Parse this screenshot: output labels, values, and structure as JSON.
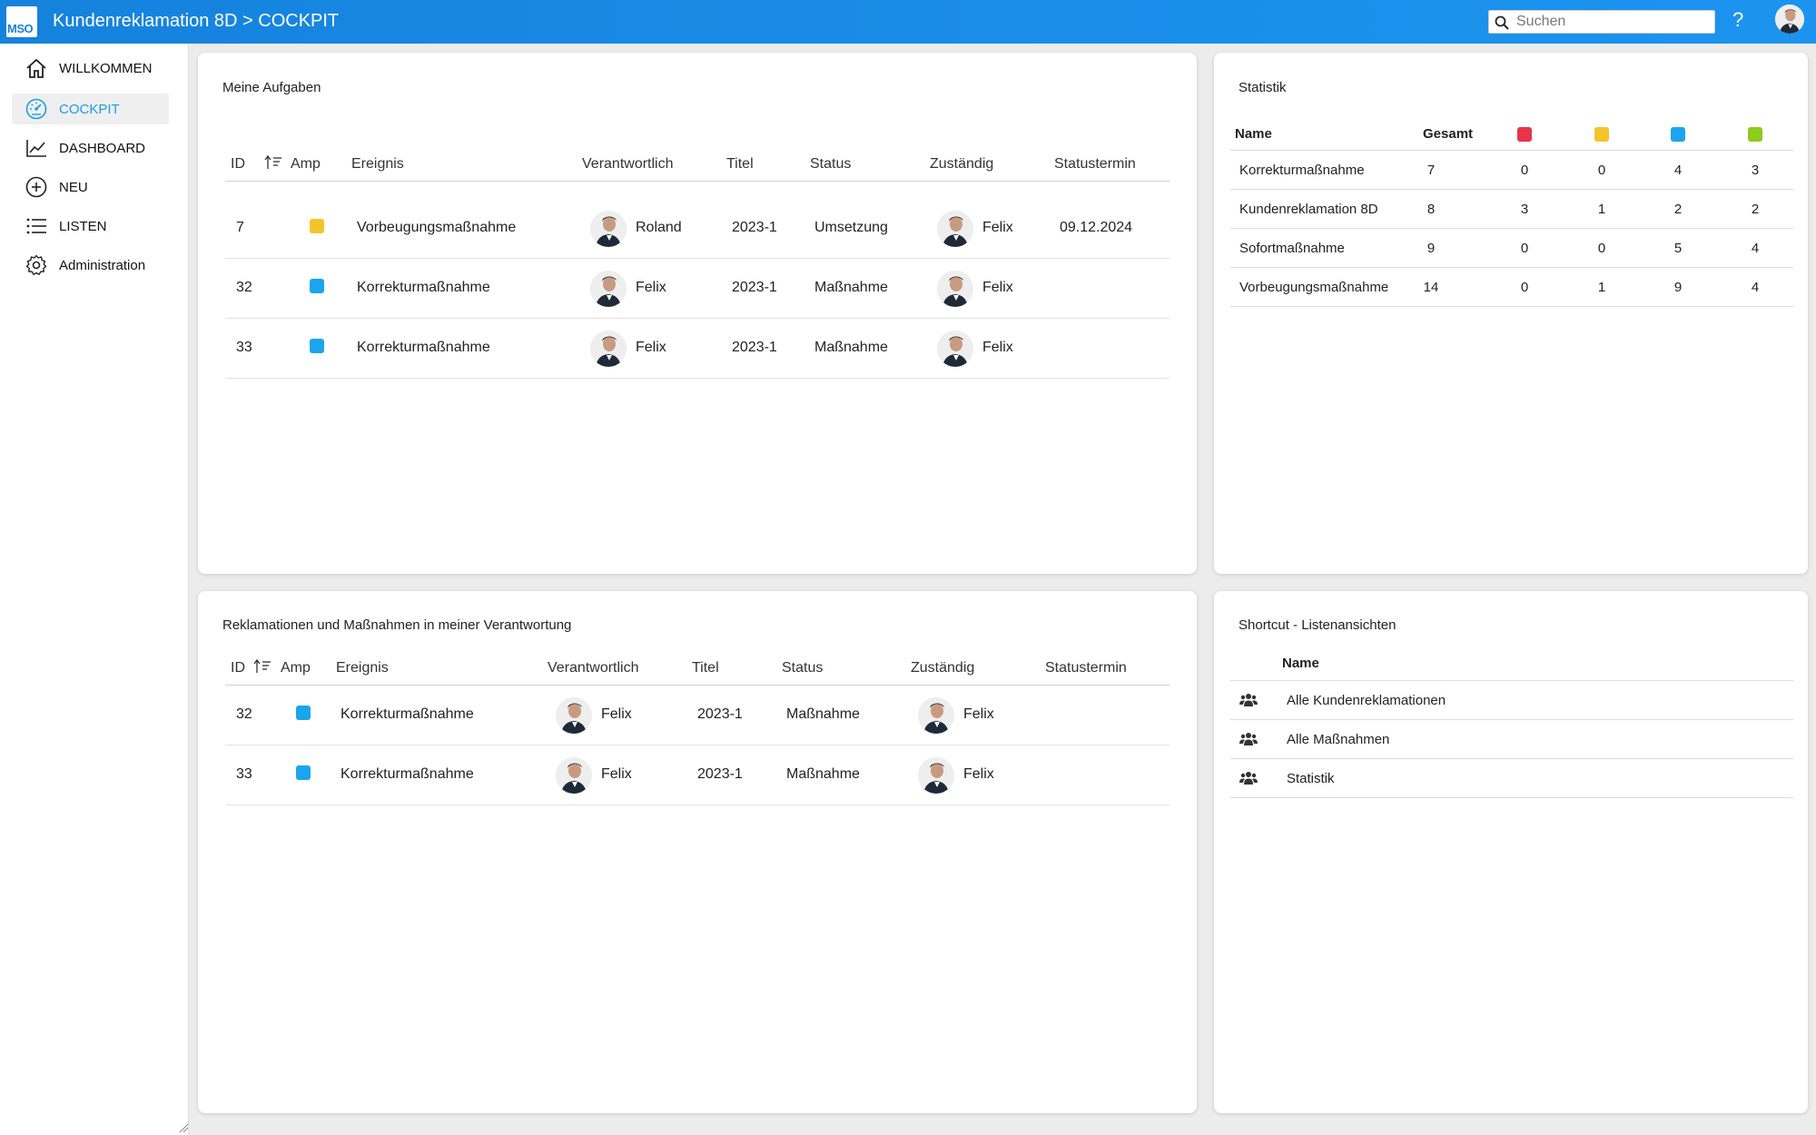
{
  "colors": {
    "red": "#e8334b",
    "yellow": "#f4c52a",
    "blue": "#1ba5ee",
    "green": "#8ccc1a",
    "accent": "#1a8ee9"
  },
  "header": {
    "logo_text": "MSO",
    "title": "Kundenreklamation 8D > COCKPIT",
    "search_placeholder": "Suchen",
    "help": "?"
  },
  "sidebar": {
    "items": [
      {
        "label": "WILLKOMMEN",
        "icon": "home-icon"
      },
      {
        "label": "COCKPIT",
        "icon": "gauge-icon",
        "active": true
      },
      {
        "label": "DASHBOARD",
        "icon": "chart-line-icon"
      },
      {
        "label": "NEU",
        "icon": "plus-circle-icon"
      },
      {
        "label": "LISTEN",
        "icon": "list-icon"
      },
      {
        "label": "Administration",
        "icon": "gear-icon"
      }
    ]
  },
  "tasks": {
    "title": "Meine Aufgaben",
    "columns": [
      "ID",
      "Amp",
      "Ereignis",
      "Verantwortlich",
      "Titel",
      "Status",
      "Zuständig",
      "Statustermin"
    ],
    "rows": [
      {
        "id": "7",
        "amp": "yellow",
        "ereignis": "Vorbeugungsmaßnahme",
        "verantwortlich": "Roland",
        "titel": "2023-1",
        "status": "Umsetzung",
        "zustaendig": "Felix",
        "termin": "09.12.2024"
      },
      {
        "id": "32",
        "amp": "blue",
        "ereignis": "Korrekturmaßnahme",
        "verantwortlich": "Felix",
        "titel": "2023-1",
        "status": "Maßnahme",
        "zustaendig": "Felix",
        "termin": ""
      },
      {
        "id": "33",
        "amp": "blue",
        "ereignis": "Korrekturmaßnahme",
        "verantwortlich": "Felix",
        "titel": "2023-1",
        "status": "Maßnahme",
        "zustaendig": "Felix",
        "termin": ""
      }
    ]
  },
  "responsibility": {
    "title": "Reklamationen und Maßnahmen in meiner Verantwortung",
    "columns": [
      "ID",
      "Amp",
      "Ereignis",
      "Verantwortlich",
      "Titel",
      "Status",
      "Zuständig",
      "Statustermin"
    ],
    "rows": [
      {
        "id": "32",
        "amp": "blue",
        "ereignis": "Korrekturmaßnahme",
        "verantwortlich": "Felix",
        "titel": "2023-1",
        "status": "Maßnahme",
        "zustaendig": "Felix"
      },
      {
        "id": "33",
        "amp": "blue",
        "ereignis": "Korrekturmaßnahme",
        "verantwortlich": "Felix",
        "titel": "2023-1",
        "status": "Maßnahme",
        "zustaendig": "Felix"
      }
    ]
  },
  "statistik": {
    "title": "Statistik",
    "col_name": "Name",
    "col_total": "Gesamt",
    "rows": [
      {
        "name": "Korrekturmaßnahme",
        "gesamt": "7",
        "red": "0",
        "yellow": "0",
        "blue": "4",
        "green": "3"
      },
      {
        "name": "Kundenreklamation 8D",
        "gesamt": "8",
        "red": "3",
        "yellow": "1",
        "blue": "2",
        "green": "2"
      },
      {
        "name": "Sofortmaßnahme",
        "gesamt": "9",
        "red": "0",
        "yellow": "0",
        "blue": "5",
        "green": "4"
      },
      {
        "name": "Vorbeugungsmaßnahme",
        "gesamt": "14",
        "red": "0",
        "yellow": "1",
        "blue": "9",
        "green": "4"
      }
    ]
  },
  "shortcuts": {
    "title": "Shortcut - Listenansichten",
    "col_name": "Name",
    "items": [
      {
        "label": "Alle Kundenreklamationen",
        "icon": "users-icon"
      },
      {
        "label": "Alle Maßnahmen",
        "icon": "users-icon"
      },
      {
        "label": "Statistik",
        "icon": "users-icon"
      }
    ]
  }
}
